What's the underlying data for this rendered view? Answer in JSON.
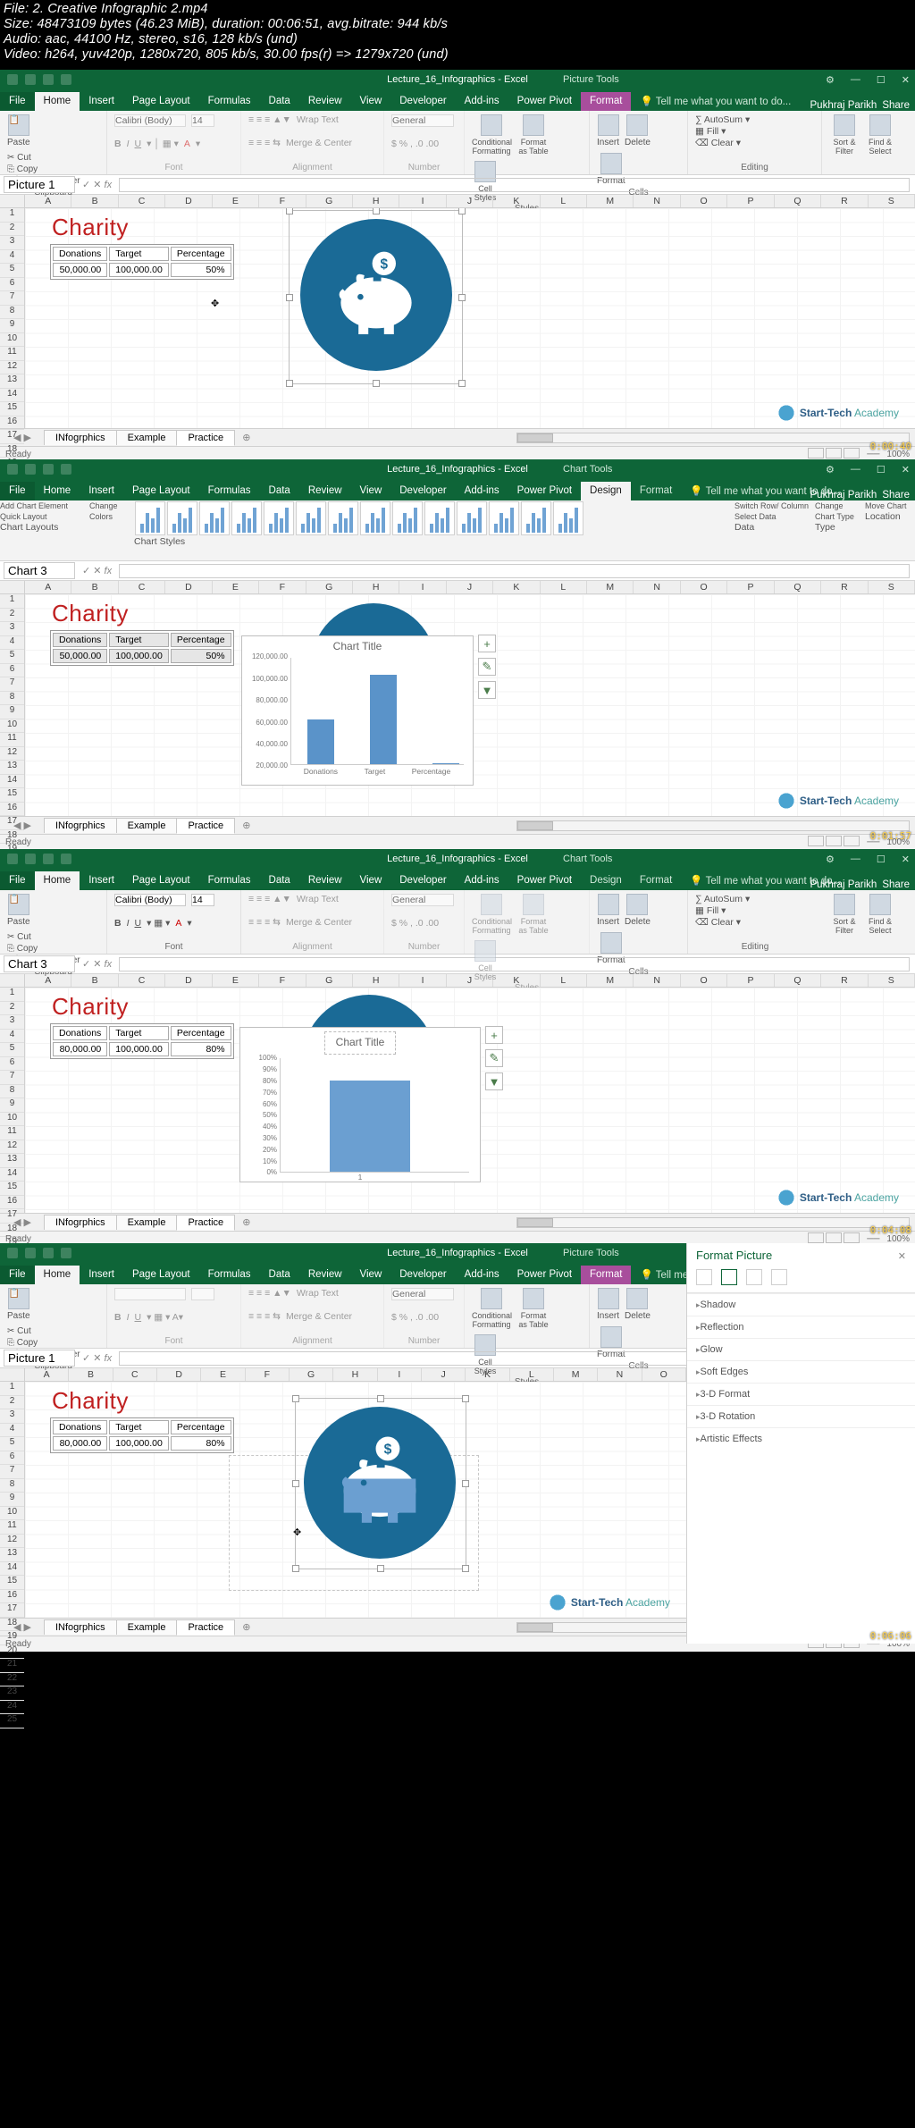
{
  "meta": {
    "l1": "File: 2. Creative Infographic 2.mp4",
    "l2": "Size: 48473109 bytes (46.23 MiB), duration: 00:06:51, avg.bitrate: 944 kb/s",
    "l3": "Audio: aac, 44100 Hz, stereo, s16, 128 kb/s (und)",
    "l4": "Video: h264, yuv420p, 1280x720, 805 kb/s, 30.00 fps(r) => 1279x720 (und)"
  },
  "common": {
    "docname": "Lecture_16_Infographics - Excel",
    "user": "Pukhraj Parikh",
    "share": "Share",
    "tell": "Tell me what you want to do...",
    "menus": [
      "File",
      "Home",
      "Insert",
      "Page Layout",
      "Formulas",
      "Data",
      "Review",
      "View",
      "Developer",
      "Add-ins",
      "Power Pivot"
    ],
    "contextPicture": "Picture Tools",
    "contextChart": "Chart Tools",
    "formatTab": "Format",
    "designTab": "Design",
    "sheet_tabs": [
      "INfogrphics",
      "Example",
      "Practice"
    ],
    "ready": "Ready",
    "zoom": "100%",
    "watermark1": "Start-Tech",
    "watermark2": "Academy",
    "charity": "Charity",
    "tbl_h": [
      "Donations",
      "Target",
      "Percentage"
    ],
    "chart_title": "Chart Title"
  },
  "ribbon_home": {
    "clipboard": {
      "name": "Clipboard",
      "paste": "Paste",
      "cut": "Cut",
      "copy": "Copy",
      "painter": "Format Painter"
    },
    "font": {
      "name": "Font",
      "family": "Calibri (Body)",
      "size": "14"
    },
    "alignment": {
      "name": "Alignment",
      "wrap": "Wrap Text",
      "merge": "Merge & Center"
    },
    "number": {
      "name": "Number",
      "format": "General"
    },
    "styles": {
      "name": "Styles",
      "cond": "Conditional Formatting",
      "fmtas": "Format as Table",
      "cell": "Cell Styles"
    },
    "cells": {
      "name": "Cells",
      "insert": "Insert",
      "delete": "Delete",
      "format": "Format"
    },
    "editing": {
      "name": "Editing",
      "autosum": "AutoSum",
      "fill": "Fill",
      "clear": "Clear",
      "sort": "Sort & Filter",
      "find": "Find & Select"
    }
  },
  "ribbon_design": {
    "layouts": "Chart Layouts",
    "add": "Add Chart Element",
    "quick": "Quick Layout",
    "colors": "Change Colors",
    "styles": "Chart Styles",
    "data": "Data",
    "switch": "Switch Row/ Column",
    "select": "Select Data",
    "type": "Type",
    "change": "Change Chart Type",
    "location": "Location",
    "move": "Move Chart"
  },
  "panel1": {
    "namebox": "Picture 1",
    "cols": [
      "A",
      "B",
      "C",
      "D",
      "E",
      "F",
      "G",
      "H",
      "I",
      "J",
      "K",
      "L",
      "M",
      "N",
      "O",
      "P",
      "Q",
      "R",
      "S"
    ],
    "rowcount": 23,
    "data": [
      "50,000.00",
      "100,000.00",
      "50%"
    ],
    "ts": "0:00:40"
  },
  "panel2": {
    "namebox": "Chart 3",
    "cols": [
      "A",
      "B",
      "C",
      "D",
      "E",
      "F",
      "G",
      "H",
      "I",
      "J",
      "K",
      "L",
      "M",
      "N",
      "O",
      "P",
      "Q",
      "R",
      "S"
    ],
    "rowcount": 23,
    "data": [
      "50,000.00",
      "100,000.00",
      "50%"
    ],
    "ts": "0:01:57",
    "chart_data": {
      "type": "bar",
      "categories": [
        "Donations",
        "Target",
        "Percentage"
      ],
      "values": [
        50000,
        100000,
        0.5
      ],
      "y_ticks": [
        "20,000.00",
        "40,000.00",
        "60,000.00",
        "80,000.00",
        "100,000.00",
        "120,000.00"
      ],
      "title": "Chart Title"
    },
    "sidebtn": [
      "+",
      "✎",
      "▼"
    ]
  },
  "panel3": {
    "namebox": "Chart 3",
    "cols": [
      "A",
      "B",
      "C",
      "D",
      "E",
      "F",
      "G",
      "H",
      "I",
      "J",
      "K",
      "L",
      "M",
      "N",
      "O",
      "P",
      "Q",
      "R",
      "S"
    ],
    "rowcount": 24,
    "data": [
      "80,000.00",
      "100,000.00",
      "80%"
    ],
    "ts": "0:04:08",
    "chart_data": {
      "type": "bar",
      "categories": [
        "1"
      ],
      "values": [
        80
      ],
      "y_ticks": [
        "0%",
        "10%",
        "20%",
        "30%",
        "40%",
        "50%",
        "60%",
        "70%",
        "80%",
        "90%",
        "100%"
      ],
      "title": "Chart Title"
    },
    "sidebtn": [
      "+",
      "✎",
      "▼"
    ]
  },
  "panel4": {
    "namebox": "Picture 1",
    "cols": [
      "A",
      "B",
      "C",
      "D",
      "E",
      "F",
      "G",
      "H",
      "I",
      "J",
      "K",
      "L",
      "M",
      "N",
      "O"
    ],
    "rowcount": 25,
    "data": [
      "80,000.00",
      "100,000.00",
      "80%"
    ],
    "ts": "0:06:06",
    "fmt": {
      "title": "Format Picture",
      "opts": [
        "Shadow",
        "Reflection",
        "Glow",
        "Soft Edges",
        "3-D Format",
        "3-D Rotation",
        "Artistic Effects"
      ]
    }
  }
}
